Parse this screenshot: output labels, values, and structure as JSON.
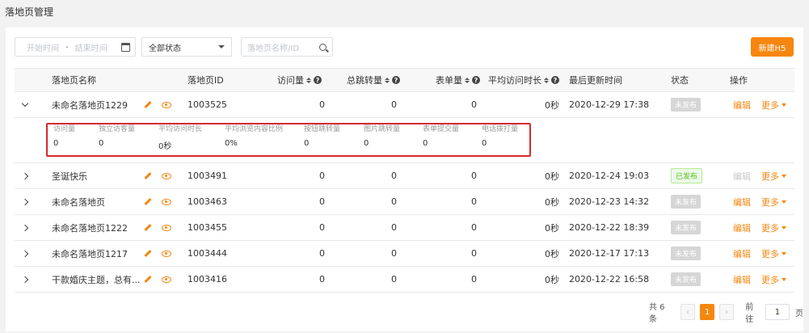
{
  "page_title": "落地页管理",
  "filters": {
    "start_placeholder": "开始时间",
    "range_sep": "-",
    "end_placeholder": "结束时间",
    "status_value": "全部状态",
    "search_placeholder": "落地页名称/ID"
  },
  "new_button": "新建H5",
  "columns": {
    "name": "落地页名称",
    "id": "落地页ID",
    "visits": "访问量",
    "jumps": "总跳转量",
    "forms": "表单量",
    "avg_time": "平均访问时长",
    "updated": "最后更新时间",
    "status": "状态",
    "actions": "操作"
  },
  "help_glyph": "?",
  "rows": [
    {
      "name": "未命名落地页1229",
      "id": "1003525",
      "visits": "0",
      "jumps": "0",
      "forms": "0",
      "avg_time": "0秒",
      "updated": "2020-12-29 17:38",
      "status": "未发布",
      "published": false,
      "edit": "编辑",
      "more": "更多",
      "expanded": true
    },
    {
      "name": "圣诞快乐",
      "id": "1003491",
      "visits": "0",
      "jumps": "0",
      "forms": "0",
      "avg_time": "0秒",
      "updated": "2020-12-24 19:03",
      "status": "已发布",
      "published": true,
      "edit": "编辑",
      "more": "更多",
      "expanded": false
    },
    {
      "name": "未命名落地页",
      "id": "1003463",
      "visits": "0",
      "jumps": "0",
      "forms": "0",
      "avg_time": "0秒",
      "updated": "2020-12-23 14:32",
      "status": "未发布",
      "published": false,
      "edit": "编辑",
      "more": "更多",
      "expanded": false
    },
    {
      "name": "未命名落地页1222",
      "id": "1003455",
      "visits": "0",
      "jumps": "0",
      "forms": "0",
      "avg_time": "0秒",
      "updated": "2020-12-22 18:39",
      "status": "未发布",
      "published": false,
      "edit": "编辑",
      "more": "更多",
      "expanded": false
    },
    {
      "name": "未命名落地页1217",
      "id": "1003444",
      "visits": "0",
      "jumps": "0",
      "forms": "0",
      "avg_time": "0秒",
      "updated": "2020-12-17 17:13",
      "status": "未发布",
      "published": false,
      "edit": "编辑",
      "more": "更多",
      "expanded": false
    },
    {
      "name": "干款婚庆主题，总有...",
      "id": "1003416",
      "visits": "0",
      "jumps": "0",
      "forms": "0",
      "avg_time": "0秒",
      "updated": "2020-12-22 16:58",
      "status": "未发布",
      "published": false,
      "edit": "编辑",
      "more": "更多",
      "expanded": false
    }
  ],
  "detail_stats": [
    {
      "label": "访问量",
      "value": "0"
    },
    {
      "label": "独立访客量",
      "value": "0"
    },
    {
      "label": "平均访问时长",
      "value": "0秒"
    },
    {
      "label": "平均浏览内容比例",
      "value": "0%"
    },
    {
      "label": "按钮跳转量",
      "value": "0"
    },
    {
      "label": "图片跳转量",
      "value": "0"
    },
    {
      "label": "表单提交量",
      "value": "0"
    },
    {
      "label": "电话拨打量",
      "value": "0"
    }
  ],
  "pagination": {
    "total_text": "共 6 条",
    "prev": "‹",
    "current": "1",
    "next": "›",
    "goto_label": "前往",
    "goto_value": "1",
    "page_suffix": "页"
  },
  "colors": {
    "accent": "#f6860f",
    "highlight_border": "#d42b2b",
    "published": "#52c41a"
  }
}
